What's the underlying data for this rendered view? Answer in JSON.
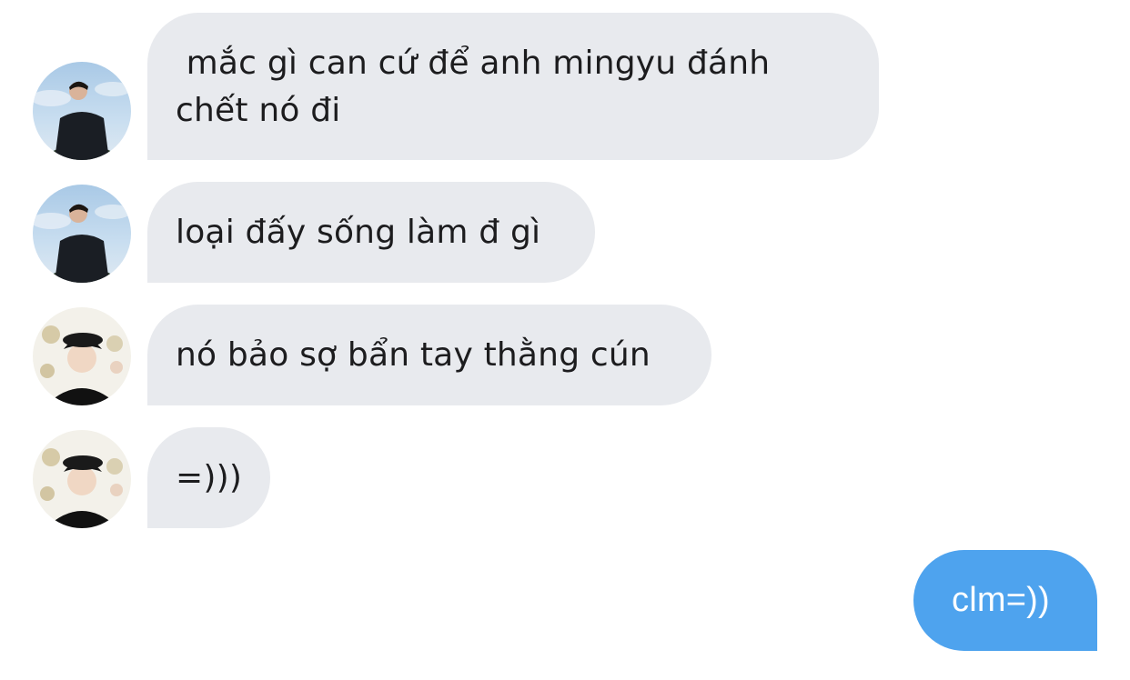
{
  "conversation": {
    "messages": [
      {
        "direction": "incoming",
        "sender_avatar": "profile-photo-outdoor-avatar",
        "text": " mắc gì can cứ để anh mingyu đánh chết nó đi"
      },
      {
        "direction": "incoming",
        "sender_avatar": "profile-photo-outdoor-avatar",
        "text": "loại đấy sống làm đ gì"
      },
      {
        "direction": "incoming",
        "sender_avatar": "profile-photo-cap-avatar",
        "text": "nó bảo sợ bẩn tay thằng cún"
      },
      {
        "direction": "incoming",
        "sender_avatar": "profile-photo-cap-avatar",
        "text": "=)))"
      },
      {
        "direction": "outgoing",
        "text": "clm=))"
      }
    ]
  },
  "colors": {
    "incoming_bubble": "#e8eaee",
    "outgoing_bubble": "#4ea3ee",
    "incoming_text": "#1c1c1e",
    "outgoing_text": "#ffffff",
    "background": "#ffffff"
  }
}
